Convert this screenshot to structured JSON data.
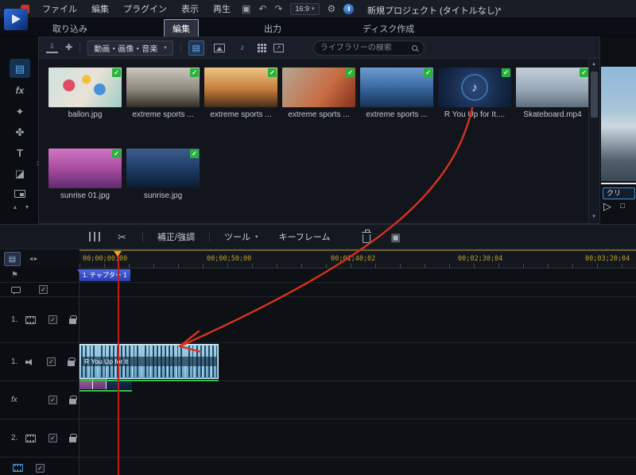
{
  "colors": {
    "accent_blue": "#3f8ede",
    "check_green": "#27b33b",
    "ruler_gold": "#c2a02c",
    "annotation_red": "#d8321f",
    "keyframe_green": "#2fc14a",
    "chapter_blue": "#4c68e8",
    "audio_clip_blue": "#6aa6c8"
  },
  "icons": {
    "caret": "▾",
    "check": "✓",
    "up": "▲",
    "down": "▼",
    "undo": "↶",
    "redo": "↷",
    "scissors": "✂",
    "gear": "⚙",
    "flag": "⚑",
    "note": "♪",
    "play": "▷",
    "stop": "□",
    "fit": "◄►",
    "media": "▤",
    "fx": "fx",
    "pip": "✦",
    "particle": "✤",
    "title": "T",
    "transition": "◪",
    "import": "⇩",
    "plugin": "✚",
    "detach": "↗",
    "expander": "›",
    "panel": "▣",
    "export": "▣"
  },
  "menubar": {
    "items": [
      "ファイル",
      "編集",
      "プラグイン",
      "表示",
      "再生"
    ],
    "aspect_ratio": "16:9",
    "project_title": "新規プロジェクト (タイトルなし)*"
  },
  "tabs": [
    {
      "label": "取り込み"
    },
    {
      "label": "編集"
    },
    {
      "label": "出力"
    },
    {
      "label": "ディスク作成"
    }
  ],
  "library": {
    "filter_label": "動画・画像・音楽",
    "search_placeholder": "ライブラリーの検索",
    "items": [
      {
        "name": "ballon.jpg"
      },
      {
        "name": "extreme sports ..."
      },
      {
        "name": "extreme sports ..."
      },
      {
        "name": "extreme sports ..."
      },
      {
        "name": "extreme sports ..."
      },
      {
        "name": "R You Up for It...."
      },
      {
        "name": "Skateboard.mp4"
      },
      {
        "name": "sunrise 01.jpg"
      },
      {
        "name": "sunrise.jpg"
      }
    ]
  },
  "preview": {
    "clip_button": "クリ"
  },
  "tools": {
    "fix": "補正/強調",
    "tools_label": "ツール",
    "keyframe": "キーフレーム"
  },
  "timeline": {
    "ruler": [
      "00;00;00;00",
      "00;00;50;00",
      "00;01;40;02",
      "00;02;30;04",
      "00;03;20;04"
    ],
    "chapter_marker": "1. チャプター 1",
    "audio_clip_label": "R You Up for It",
    "tracks": [
      {
        "num": "1."
      },
      {
        "num": "1."
      },
      {
        "num": "fx"
      },
      {
        "num": "2."
      }
    ]
  }
}
